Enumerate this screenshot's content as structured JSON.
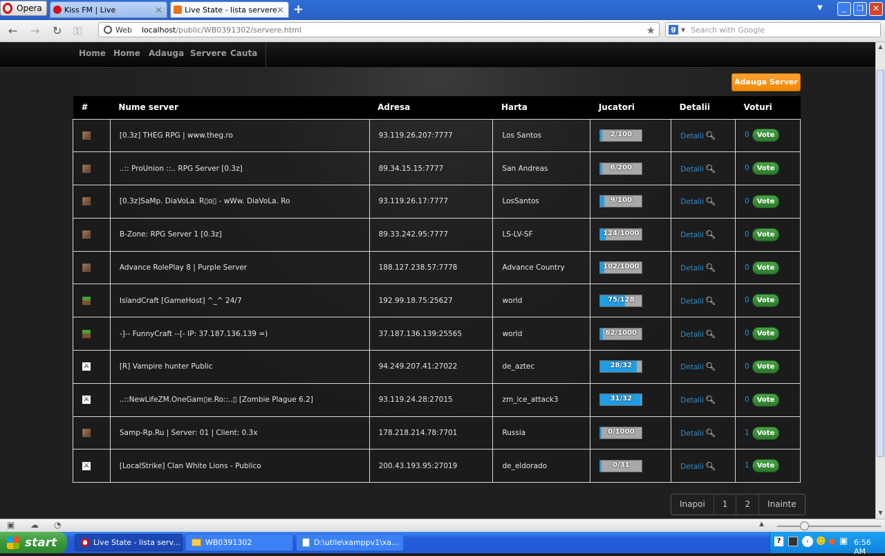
{
  "browser": {
    "menu_label": "Opera",
    "tabs": [
      {
        "label": "Kiss FM | Live"
      },
      {
        "label": "Live State - lista servere"
      }
    ],
    "search_engine_label": "Web",
    "url_host": "localhost",
    "url_path": "/public/WB0391302/servere.html",
    "search_placeholder": "Search with Google"
  },
  "site": {
    "nav": [
      "Home",
      "Home",
      "Adauga",
      "Servere",
      "Cauta"
    ],
    "add_server_label": "Adauga Server",
    "table": {
      "columns": [
        "#",
        "Nume server",
        "Adresa",
        "Harta",
        "Jucatori",
        "Detalii",
        "Voturi"
      ],
      "details_label": "Detalii",
      "vote_label": "Vote",
      "rows": [
        {
          "game": "samp",
          "name": "[0.3z] THEG RPG | www.theg.ro",
          "address": "93.119.26.207:7777",
          "map": "Los Santos",
          "players": "2/100",
          "fill": 0.02,
          "votes": "0"
        },
        {
          "game": "samp",
          "name": "..:: ProUnion ::.. RPG Server [0.3z]",
          "address": "89.34.15.15:7777",
          "map": "San Andreas",
          "players": "6/200",
          "fill": 0.03,
          "votes": "0"
        },
        {
          "game": "samp",
          "name": "[0.3z]SaMp. DiaVoLa. R▯o▯ - wWw. DiaVoLa. Ro",
          "address": "93.119.26.17:7777",
          "map": "LosSantos",
          "players": "9/100",
          "fill": 0.09,
          "votes": "0"
        },
        {
          "game": "samp",
          "name": "B-Zone: RPG Server 1 [0.3z]",
          "address": "89.33.242.95:7777",
          "map": "LS-LV-SF",
          "players": "124/1000",
          "fill": 0.124,
          "votes": "0"
        },
        {
          "game": "samp",
          "name": "Advance RolePlay 8 | Purple Server",
          "address": "188.127.238.57:7778",
          "map": "Advance Country",
          "players": "102/1000",
          "fill": 0.102,
          "votes": "0"
        },
        {
          "game": "minecraft",
          "name": "IslandCraft [GameHost] ^_^ 24/7",
          "address": "192.99.18.75:25627",
          "map": "world",
          "players": "75/128",
          "fill": 0.586,
          "votes": "0"
        },
        {
          "game": "minecraft",
          "name": "-]-- FunnyCraft --[- IP: 37.187.136.139 =)",
          "address": "37.187.136.139:25565",
          "map": "world",
          "players": "62/1000",
          "fill": 0.062,
          "votes": "0"
        },
        {
          "game": "cs",
          "name": "[R] Vampire hunter Public",
          "address": "94.249.207.41:27022",
          "map": "de_aztec",
          "players": "28/32",
          "fill": 0.875,
          "votes": "0"
        },
        {
          "game": "cs",
          "name": "..::NewLifeZM.OneGam▯e.Ro::..▯ [Zombie Plague 6.2]",
          "address": "93.119.24.28:27015",
          "map": "zm_ice_attack3",
          "players": "31/32",
          "fill": 0.969,
          "votes": "0"
        },
        {
          "game": "samp",
          "name": "Samp-Rp.Ru | Server: 01 | Client: 0.3x",
          "address": "178.218.214.78:7701",
          "map": "Russia",
          "players": "0/1000",
          "fill": 0,
          "votes": "1"
        },
        {
          "game": "cs",
          "name": "[LocalStrike] Clan White Lions - Publico",
          "address": "200.43.193.95:27019",
          "map": "de_eldorado",
          "players": "0/31",
          "fill": 0,
          "votes": "1"
        }
      ]
    },
    "pagination": [
      "Inapoi",
      "1",
      "2",
      "Inainte"
    ]
  },
  "taskbar": {
    "start_label": "start",
    "items": [
      {
        "label": "Live State - lista serv..."
      },
      {
        "label": "WB0391302"
      },
      {
        "label": "D:\\utile\\xamppv1\\xa..."
      }
    ],
    "clock": "6:56 AM"
  }
}
